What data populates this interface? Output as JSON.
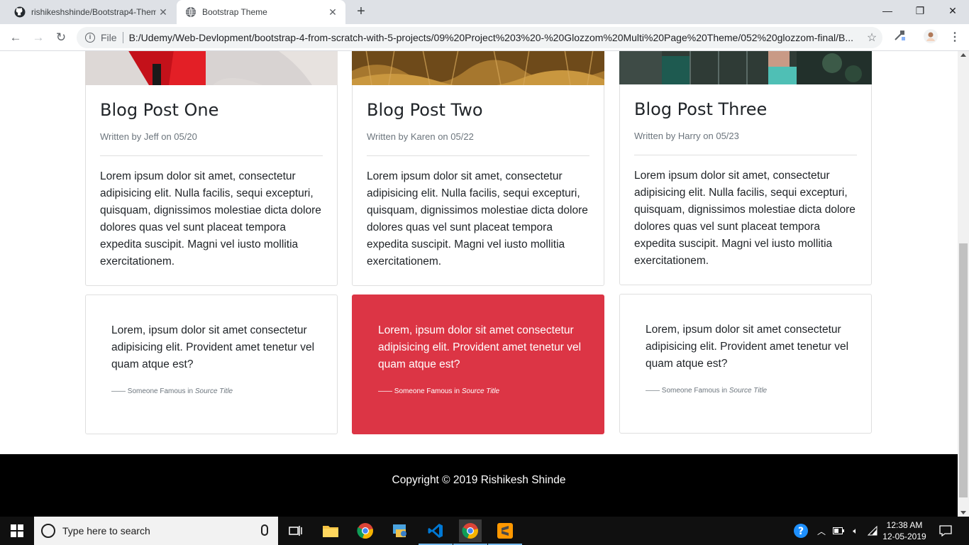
{
  "browser": {
    "tabs": [
      {
        "title": "rishikeshshinde/Bootstrap4-Them",
        "favicon": "github-icon"
      },
      {
        "title": "Bootstrap Theme",
        "favicon": "globe-icon"
      }
    ],
    "address": {
      "scheme_label": "File",
      "url": "B:/Udemy/Web-Devlopment/bootstrap-4-from-scratch-with-5-projects/09%20Project%203%20-%20Glozzom%20Multi%20Page%20Theme/052%20glozzom-final/B..."
    }
  },
  "blog_posts": [
    {
      "title": "Blog Post One",
      "meta": "Written by Jeff on 05/20",
      "body": "Lorem ipsum dolor sit amet, consectetur adipisicing elit. Nulla facilis, sequi excepturi, quisquam, dignissimos molestiae dicta dolore dolores quas vel sunt placeat tempora expedita suscipit. Magni vel iusto mollitia exercitationem."
    },
    {
      "title": "Blog Post Two",
      "meta": "Written by Karen on 05/22",
      "body": "Lorem ipsum dolor sit amet, consectetur adipisicing elit. Nulla facilis, sequi excepturi, quisquam, dignissimos molestiae dicta dolore dolores quas vel sunt placeat tempora expedita suscipit. Magni vel iusto mollitia exercitationem."
    },
    {
      "title": "Blog Post Three",
      "meta": "Written by Harry on 05/23",
      "body": "Lorem ipsum dolor sit amet, consectetur adipisicing elit. Nulla facilis, sequi excepturi, quisquam, dignissimos molestiae dicta dolore dolores quas vel sunt placeat tempora expedita suscipit. Magni vel iusto mollitia exercitationem."
    }
  ],
  "quotes": [
    {
      "text": "Lorem, ipsum dolor sit amet consectetur adipisicing elit. Provident amet tenetur vel quam atque est?",
      "author": "Someone Famous in",
      "source": "Source Title"
    },
    {
      "text": "Lorem, ipsum dolor sit amet consectetur adipisicing elit. Provident amet tenetur vel quam atque est?",
      "author": "Someone Famous in",
      "source": "Source Title"
    },
    {
      "text": "Lorem, ipsum dolor sit amet consectetur adipisicing elit. Provident amet tenetur vel quam atque est?",
      "author": "Someone Famous in",
      "source": "Source Title"
    }
  ],
  "footer": {
    "copyright": "Copyright © 2019 Rishikesh Shinde"
  },
  "taskbar": {
    "search_placeholder": "Type here to search",
    "time": "12:38 AM",
    "date": "12-05-2019"
  },
  "colors": {
    "accent_red": "#dc3545",
    "footer_bg": "#000000"
  }
}
